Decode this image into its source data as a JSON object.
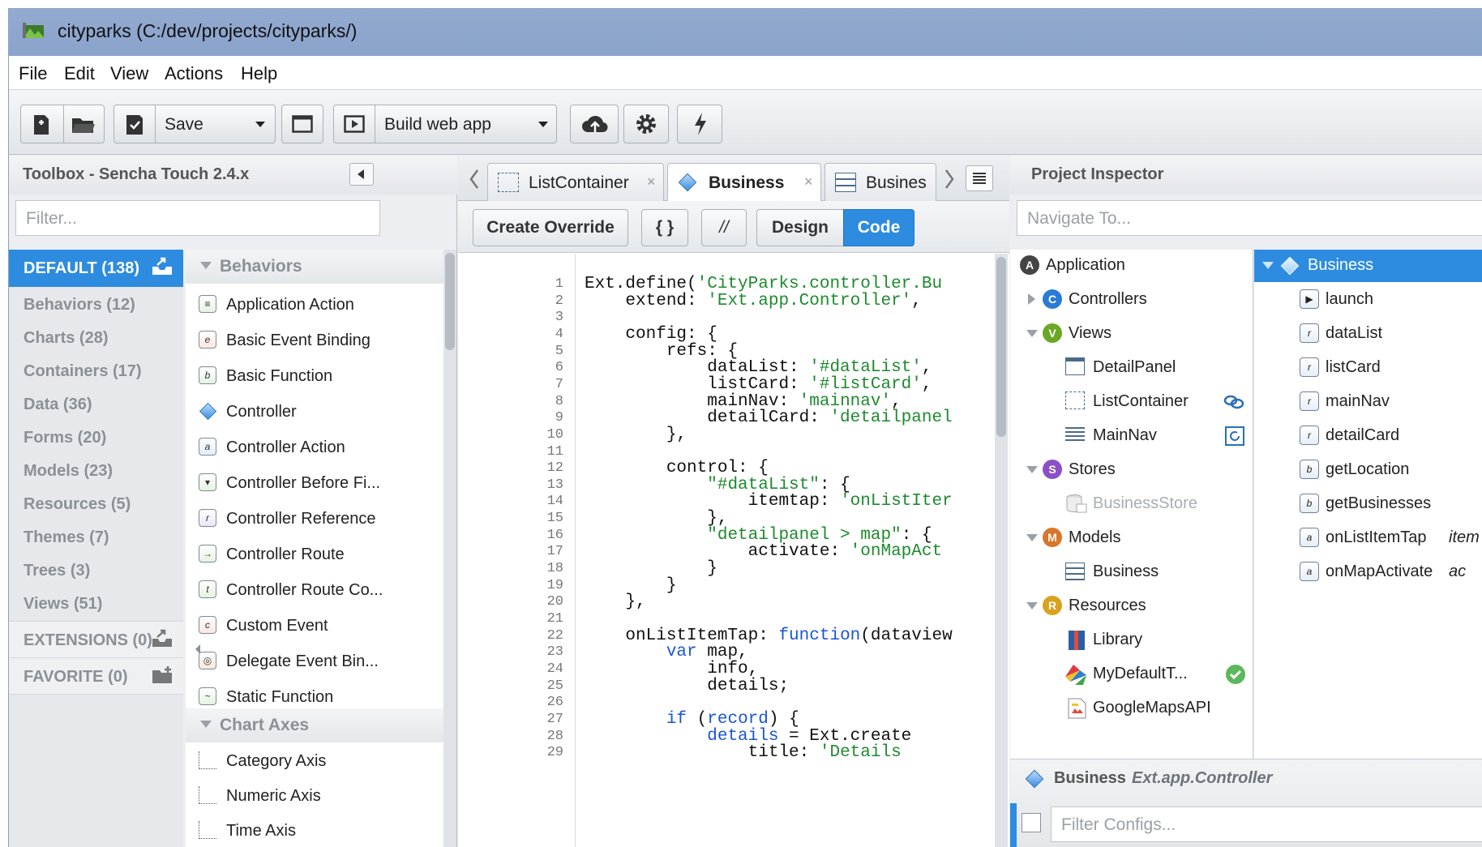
{
  "window": {
    "title": "cityparks (C:/dev/projects/cityparks/)"
  },
  "menu": [
    "File",
    "Edit",
    "View",
    "Actions",
    "Help"
  ],
  "toolbar": {
    "save_label": "Save",
    "build_label": "Build web app"
  },
  "toolbox": {
    "title": "Toolbox - Sencha Touch 2.4.x",
    "filter_placeholder": "Filter...",
    "categories": [
      {
        "label": "DEFAULT (138)"
      },
      {
        "label": "Behaviors (12)"
      },
      {
        "label": "Charts (28)"
      },
      {
        "label": "Containers (17)"
      },
      {
        "label": "Data (36)"
      },
      {
        "label": "Forms (20)"
      },
      {
        "label": "Models (23)"
      },
      {
        "label": "Resources (5)"
      },
      {
        "label": "Themes (7)"
      },
      {
        "label": "Trees (3)"
      },
      {
        "label": "Views (51)"
      },
      {
        "label": "EXTENSIONS (0)"
      },
      {
        "label": "FAVORITE (0)"
      }
    ],
    "groups": [
      {
        "label": "Behaviors"
      },
      {
        "label": "Chart Axes"
      }
    ],
    "items": [
      {
        "label": "Application Action",
        "icon": "action-icon",
        "glyph": "≡"
      },
      {
        "label": "Basic Event Binding",
        "icon": "event-binding-icon",
        "glyph": "e"
      },
      {
        "label": "Basic Function",
        "icon": "function-icon",
        "glyph": "b"
      },
      {
        "label": "Controller",
        "icon": "controller-diamond-icon",
        "glyph": ""
      },
      {
        "label": "Controller Action",
        "icon": "controller-action-icon",
        "glyph": "a"
      },
      {
        "label": "Controller Before Fi...",
        "icon": "before-filter-icon",
        "glyph": "▾"
      },
      {
        "label": "Controller Reference",
        "icon": "reference-icon",
        "glyph": "r"
      },
      {
        "label": "Controller Route",
        "icon": "route-icon",
        "glyph": "→"
      },
      {
        "label": "Controller Route Co...",
        "icon": "route-condition-icon",
        "glyph": "t"
      },
      {
        "label": "Custom Event",
        "icon": "custom-event-icon",
        "glyph": "c"
      },
      {
        "label": "Delegate Event Bin...",
        "icon": "delegate-icon",
        "glyph": "◎"
      },
      {
        "label": "Static Function",
        "icon": "static-function-icon",
        "glyph": "~"
      }
    ],
    "axis_items": [
      {
        "label": "Category Axis"
      },
      {
        "label": "Numeric Axis"
      },
      {
        "label": "Time Axis"
      }
    ]
  },
  "editor": {
    "tabs": [
      {
        "label": "ListContainer"
      },
      {
        "label": "Business"
      },
      {
        "label": "Busines"
      }
    ],
    "buttons": {
      "override": "Create Override",
      "braces": "{ }",
      "comment": "//",
      "design": "Design",
      "code": "Code"
    },
    "line_numbers": [
      "1",
      "2",
      "3",
      "4",
      "5",
      "6",
      "7",
      "8",
      "9",
      "10",
      "11",
      "12",
      "13",
      "14",
      "15",
      "16",
      "17",
      "18",
      "19",
      "20",
      "21",
      "22",
      "23",
      "24",
      "25",
      "26",
      "27",
      "28",
      "29"
    ],
    "lines": [
      [
        {
          "t": "Ext.define(",
          "c": ""
        },
        {
          "t": "'CityParks.controller.Bu",
          "c": "str"
        }
      ],
      [
        {
          "t": "    extend: ",
          "c": ""
        },
        {
          "t": "'Ext.app.Controller'",
          "c": "str"
        },
        {
          "t": ",",
          "c": ""
        }
      ],
      [
        {
          "t": "",
          "c": ""
        }
      ],
      [
        {
          "t": "    config: {",
          "c": ""
        }
      ],
      [
        {
          "t": "        refs: {",
          "c": ""
        }
      ],
      [
        {
          "t": "            dataList: ",
          "c": ""
        },
        {
          "t": "'#dataList'",
          "c": "str"
        },
        {
          "t": ",",
          "c": ""
        }
      ],
      [
        {
          "t": "            listCard: ",
          "c": ""
        },
        {
          "t": "'#listCard'",
          "c": "str"
        },
        {
          "t": ",",
          "c": ""
        }
      ],
      [
        {
          "t": "            mainNav: ",
          "c": ""
        },
        {
          "t": "'mainnav'",
          "c": "str"
        },
        {
          "t": ",",
          "c": ""
        }
      ],
      [
        {
          "t": "            detailCard: ",
          "c": ""
        },
        {
          "t": "'detailpanel",
          "c": "str"
        }
      ],
      [
        {
          "t": "        },",
          "c": ""
        }
      ],
      [
        {
          "t": "",
          "c": ""
        }
      ],
      [
        {
          "t": "        control: {",
          "c": ""
        }
      ],
      [
        {
          "t": "            ",
          "c": ""
        },
        {
          "t": "\"#dataList\"",
          "c": "str"
        },
        {
          "t": ": {",
          "c": ""
        }
      ],
      [
        {
          "t": "                itemtap: ",
          "c": ""
        },
        {
          "t": "'onListIter",
          "c": "str"
        }
      ],
      [
        {
          "t": "            },",
          "c": ""
        }
      ],
      [
        {
          "t": "            ",
          "c": ""
        },
        {
          "t": "\"detailpanel > map\"",
          "c": "str"
        },
        {
          "t": ": {",
          "c": ""
        }
      ],
      [
        {
          "t": "                activate: ",
          "c": ""
        },
        {
          "t": "'onMapAct",
          "c": "str"
        }
      ],
      [
        {
          "t": "            }",
          "c": ""
        }
      ],
      [
        {
          "t": "        }",
          "c": ""
        }
      ],
      [
        {
          "t": "    },",
          "c": ""
        }
      ],
      [
        {
          "t": "",
          "c": ""
        }
      ],
      [
        {
          "t": "    onListItemTap: ",
          "c": ""
        },
        {
          "t": "function",
          "c": "kw"
        },
        {
          "t": "(dataview",
          "c": ""
        }
      ],
      [
        {
          "t": "        ",
          "c": ""
        },
        {
          "t": "var",
          "c": "kw"
        },
        {
          "t": " map,",
          "c": ""
        }
      ],
      [
        {
          "t": "            info,",
          "c": ""
        }
      ],
      [
        {
          "t": "            details;",
          "c": ""
        }
      ],
      [
        {
          "t": "",
          "c": ""
        }
      ],
      [
        {
          "t": "        ",
          "c": ""
        },
        {
          "t": "if",
          "c": "kw"
        },
        {
          "t": " (",
          "c": ""
        },
        {
          "t": "record",
          "c": "kw"
        },
        {
          "t": ") {",
          "c": ""
        }
      ],
      [
        {
          "t": "            ",
          "c": ""
        },
        {
          "t": "details",
          "c": "kw"
        },
        {
          "t": " = Ext.create",
          "c": ""
        }
      ],
      [
        {
          "t": "                title: ",
          "c": ""
        },
        {
          "t": "'Details",
          "c": "str"
        }
      ]
    ]
  },
  "inspector": {
    "title": "Project Inspector",
    "navigate_placeholder": "Navigate To...",
    "tree": [
      {
        "label": "Application",
        "badge": "A",
        "color": "#444444"
      },
      {
        "label": "Controllers",
        "badge": "C",
        "color": "#2a7bd6"
      },
      {
        "label": "Views",
        "badge": "V",
        "color": "#6aa824"
      },
      {
        "label": "DetailPanel"
      },
      {
        "label": "ListContainer"
      },
      {
        "label": "MainNav"
      },
      {
        "label": "Stores",
        "badge": "S",
        "color": "#8a4fc8"
      },
      {
        "label": "BusinessStore"
      },
      {
        "label": "Models",
        "badge": "M",
        "color": "#d8762a"
      },
      {
        "label": "Business"
      },
      {
        "label": "Resources",
        "badge": "R",
        "color": "#d9a21e"
      },
      {
        "label": "Library"
      },
      {
        "label": "MyDefaultT..."
      },
      {
        "label": "GoogleMapsAPI"
      }
    ],
    "members": {
      "root": "Business",
      "items": [
        {
          "label": "launch",
          "glyph": "▶"
        },
        {
          "label": "dataList",
          "glyph": "r"
        },
        {
          "label": "listCard",
          "glyph": "r"
        },
        {
          "label": "mainNav",
          "glyph": "r"
        },
        {
          "label": "detailCard",
          "glyph": "r"
        },
        {
          "label": "getLocation",
          "glyph": "b"
        },
        {
          "label": "getBusinesses",
          "glyph": "b"
        },
        {
          "label": "onListItemTap",
          "glyph": "a",
          "param": "item"
        },
        {
          "label": "onMapActivate",
          "glyph": "a",
          "param": "ac"
        }
      ]
    },
    "selected": {
      "name": "Business",
      "type": "Ext.app.Controller"
    },
    "filter_configs_placeholder": "Filter Configs..."
  },
  "colors": {
    "accent": "#2d8ce0",
    "titlebar": "#8aa3cb",
    "string": "#1e8a2e",
    "keyword": "#1a55d6"
  }
}
